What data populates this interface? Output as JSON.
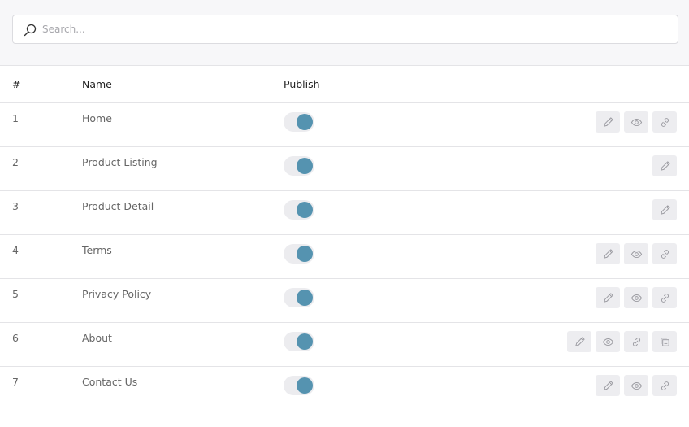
{
  "search": {
    "placeholder": "Search...",
    "value": ""
  },
  "columns": {
    "num": "#",
    "name": "Name",
    "publish": "Publish"
  },
  "colors": {
    "accent": "#5593b0",
    "toggle_track": "#ececef",
    "action_bg": "#ededf0"
  },
  "rows": [
    {
      "num": "1",
      "name": "Home",
      "published": true,
      "actions": [
        "edit",
        "view",
        "link"
      ]
    },
    {
      "num": "2",
      "name": "Product Listing",
      "published": true,
      "actions": [
        "edit"
      ]
    },
    {
      "num": "3",
      "name": "Product Detail",
      "published": true,
      "actions": [
        "edit"
      ]
    },
    {
      "num": "4",
      "name": "Terms",
      "published": true,
      "actions": [
        "edit",
        "view",
        "link"
      ]
    },
    {
      "num": "5",
      "name": "Privacy Policy",
      "published": true,
      "actions": [
        "edit",
        "view",
        "link"
      ]
    },
    {
      "num": "6",
      "name": "About",
      "published": true,
      "actions": [
        "edit",
        "view",
        "link",
        "copy"
      ]
    },
    {
      "num": "7",
      "name": "Contact Us",
      "published": true,
      "actions": [
        "edit",
        "view",
        "link"
      ]
    }
  ]
}
